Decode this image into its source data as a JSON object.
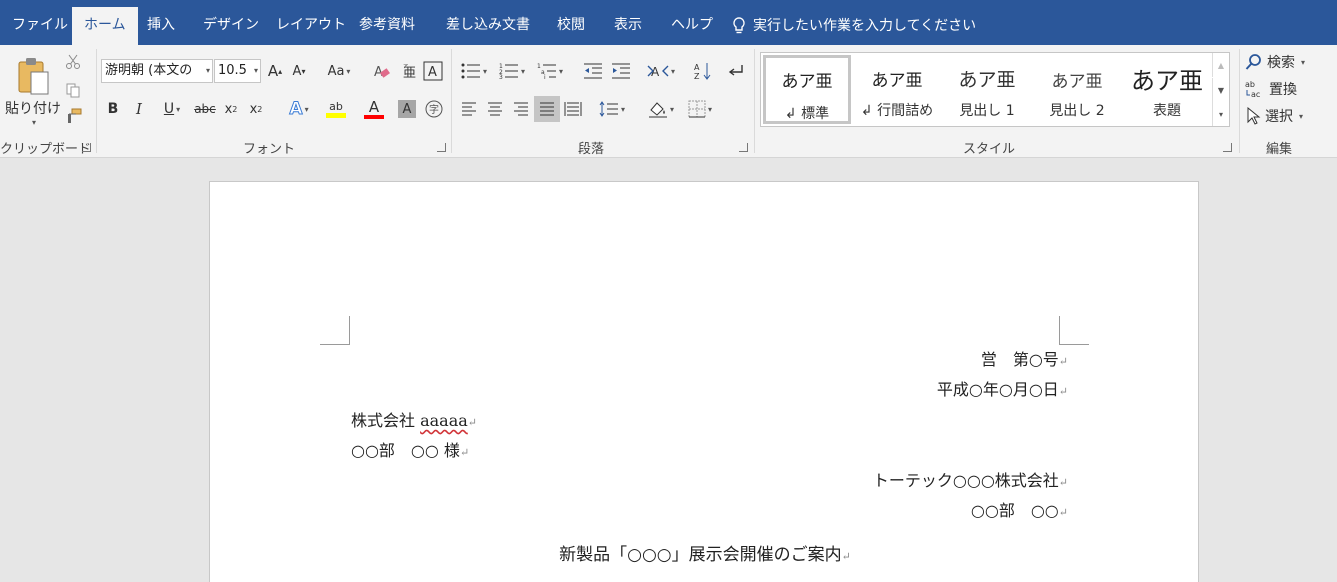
{
  "tabs": [
    "ファイル",
    "ホーム",
    "挿入",
    "デザイン",
    "レイアウト",
    "参考資料",
    "差し込み文書",
    "校閲",
    "表示",
    "ヘルプ"
  ],
  "tell_me": "実行したい作業を入力してください",
  "clipboard": {
    "paste": "貼り付け",
    "label": "クリップボード"
  },
  "font": {
    "name": "游明朝 (本文の",
    "size": "10.5",
    "case": "Aa",
    "label": "フォント"
  },
  "paragraph": {
    "label": "段落"
  },
  "styles": {
    "label": "スタイル",
    "items": [
      {
        "preview": "あア亜",
        "name": "↲ 標準"
      },
      {
        "preview": "あア亜",
        "name": "↲ 行間詰め"
      },
      {
        "preview": "あア亜",
        "name": "見出し 1"
      },
      {
        "preview": "あア亜",
        "name": "見出し 2"
      },
      {
        "preview": "あア亜",
        "name": "表題"
      }
    ]
  },
  "editing": {
    "find": "検索",
    "replace": "置換",
    "select": "選択",
    "label": "編集"
  },
  "document": {
    "line1": "営　第○号",
    "line2": "平成○年○月○日",
    "line3a": "株式会社 ",
    "line3b": "aaaaa",
    "line4": "○○部　○○ 様",
    "line5": "トーテック○○○株式会社",
    "line6": "○○部　○○",
    "line7": "新製品「○○○」展示会開催のご案内",
    "return_mark": "↵"
  },
  "colors": {
    "tabbar": "#2b579a",
    "highlight": "#ffff00",
    "font_color": "#ff0000"
  }
}
